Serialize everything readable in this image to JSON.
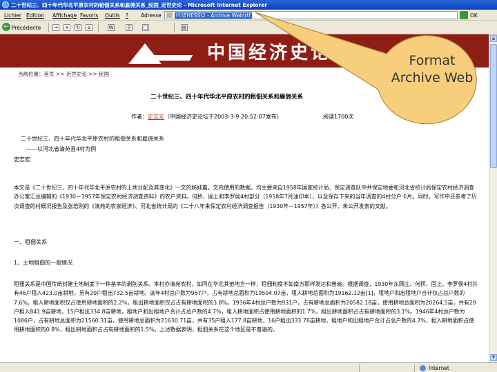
{
  "window": {
    "title": "二十世纪三、四十年代华北平原农村的租佃关系和雇佣关系_民国_近世史论 - Microsoft Internet Explorer"
  },
  "menu": {
    "items": [
      "Lichier",
      "Edition",
      "Affichage",
      "Favoris",
      "Outils",
      "?"
    ],
    "address_label": "Adresse",
    "address_value": "H:\\EHESS\\2 - Archive Web\\rtf",
    "go_label": "OK"
  },
  "toolbar": {
    "back_label": "Précédente"
  },
  "page": {
    "banner_title": "中国经济史论坛",
    "breadcrumb": "当前位置：首页 >> 近世史论 >> 民国",
    "article_title": "二十世纪三、四十年代华北平原农村的租佃关系和雇佣关系",
    "author_prefix": "作者：",
    "author_name": "史志宏",
    "author_suffix": "（中国经济史论坛于2003-3-9 20:52:07发布）",
    "view_count": "阅读1700次",
    "subtitle_line1": "二十世纪三、四十年代华北平原农村的租佃关系和雇佣关系",
    "subtitle_line2": "——以河北省清苑县4村为例",
    "author_line": "史志宏",
    "intro_paragraph": "本文是《二十世纪三、四十年代华北平原农村的土地分配及其变化》一文的姊妹篇。文内使用的数据，均主要来自1958年国家统计局、保定调查队中共保定地委和河北省统计局保定农村经济调查办公室汇总编辑的《1930－1957年保定农村经济调查资料》的农户资料。何桥、固上和李罗侯4村部分（1958年7月油印本），以及保存下来的当年调查的4村分户卡片。同时，写作中还参考了历次调查的村概况报告及张培刚的《清苑的农家经济》、河北省统计局的《二十八年来保定农村经济调查报告（1930年－1957年）》各公开、未公开发表的文献。",
    "section1": "一、租佃关系",
    "section1_1": "1、土地租佃的一般情况",
    "body_paragraph": "租佃关系是中国传统封建土地制度下一种基本的剥削关系。本村亦清苑农村，如同在华北其他地方一样，租佃制度不如南方那样发达和普遍。根据调查，1930年东顾庄、何桥、固上、李罗侯4村共有46户租入423.0亩耕地，另有20户租出732.5亩耕地。该年4村总户数为967户，占有耕地总面积为19504.07亩，租人耕地总面积为19162.12亩[1]，租地户和出租地户合计仅占总户数的7.6%，租入耕地面积仅占使用耕地面积的2.2%，租出耕地面积仅占占有耕地面积的3.8%。1936年4村总户数为931户，占有耕地总面积为20582.18亩，使用耕地总面积为20264.5亩，共有29户租入841.9亩耕地，15户租出334.8亩耕地，租地户和出租地户合计占总户数的4.7%，租入耕地面积占使用耕地面积的1.7%，租出耕地面积占占有耕地面积的3.1%。1946年4村总户数为1086户，占有耕地总面积为21560.31亩，使用耕地总面积为21630.71亩，共有35户租入177.8亩耕地，16户租出333.76亩耕地，租地户和出租地户合计占总户数的4.7%，租入耕地面积占使用耕地面积的0.8%，租出耕地面积占占有耕地面积的1.5%。上述数据表明，租佃关系在这个地区是不普遍的。"
  },
  "status": {
    "zone_label": "Internet"
  },
  "annotation": {
    "callout_text": "Format Archive Web",
    "fill_color": "#f7ce7c"
  },
  "colors": {
    "banner": "#8f1d14",
    "titlebar": "#0a3fbf",
    "chrome": "#ece9d8"
  }
}
